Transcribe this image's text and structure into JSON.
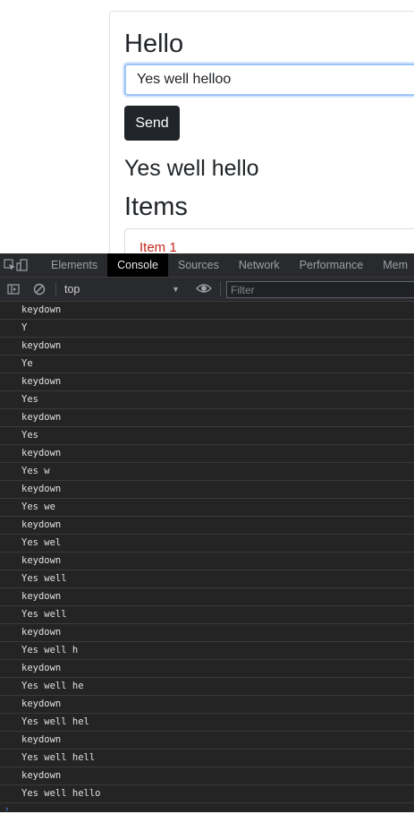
{
  "page": {
    "title": "Hello",
    "input_value": "Yes well helloo",
    "send_label": "Send",
    "echo": "Yes well hello",
    "items_heading": "Items",
    "items": [
      {
        "label": "Item 1"
      }
    ]
  },
  "devtools": {
    "tabs": [
      {
        "label": "Elements"
      },
      {
        "label": "Console"
      },
      {
        "label": "Sources"
      },
      {
        "label": "Network"
      },
      {
        "label": "Performance"
      },
      {
        "label": "Mem"
      }
    ],
    "active_tab": "Console",
    "context": "top",
    "filter_placeholder": "Filter",
    "log": [
      "keydown",
      "Y",
      "keydown",
      "Ye",
      "keydown",
      "Yes",
      "keydown",
      "Yes",
      "keydown",
      "Yes w",
      "keydown",
      "Yes we",
      "keydown",
      "Yes wel",
      "keydown",
      "Yes well",
      "keydown",
      "Yes well",
      "keydown",
      "Yes well h",
      "keydown",
      "Yes well he",
      "keydown",
      "Yes well hel",
      "keydown",
      "Yes well hell",
      "keydown",
      "Yes well hello"
    ],
    "prompt_symbol": "›"
  },
  "colors": {
    "accent_dark": "#212529",
    "item_text": "#c4271d",
    "devtools_bg": "#242424",
    "focus_ring": "#9ec5f7"
  }
}
